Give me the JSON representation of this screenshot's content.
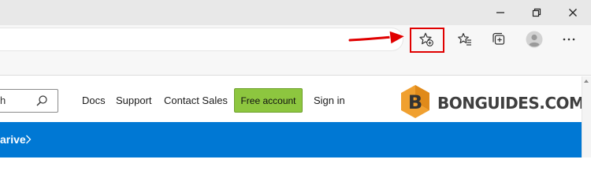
{
  "window_controls": {
    "minimize_icon": "minimize-icon",
    "restore_icon": "restore-icon",
    "close_icon": "close-icon"
  },
  "toolbar": {
    "add_favorite_icon": "star-plus-icon",
    "favorites_icon": "favorites-list-icon",
    "collections_icon": "collections-icon",
    "profile_icon": "profile-avatar-icon",
    "more_icon": "more-dots-icon"
  },
  "colors": {
    "highlight": "#e00000",
    "arrow": "#e00000",
    "free_button": "#8dc63f",
    "banner": "#0078d4",
    "logo": "#f0a030"
  },
  "page": {
    "search": {
      "text": "h"
    },
    "nav": {
      "docs": "Docs",
      "support": "Support",
      "contact_sales": "Contact Sales",
      "free_account": "Free account",
      "sign_in": "Sign in"
    },
    "watermark": {
      "text": "BONGUIDES.COM",
      "logo_letter": "B"
    },
    "banner": {
      "text": "arive"
    }
  }
}
